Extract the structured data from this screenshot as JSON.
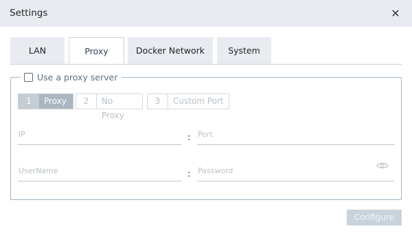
{
  "dialog": {
    "title": "Settings",
    "close_glyph": "✕"
  },
  "tabs": [
    {
      "label": "LAN",
      "active": false
    },
    {
      "label": "Proxy",
      "active": true
    },
    {
      "label": "Docker Network",
      "active": false
    },
    {
      "label": "System",
      "active": false
    }
  ],
  "proxy": {
    "use_proxy_label": "Use a proxy server",
    "use_proxy_checked": false,
    "steps": [
      {
        "number": "1",
        "label": "Proxy",
        "active": true
      },
      {
        "number": "2",
        "label": "No Proxy",
        "active": false
      },
      {
        "number": "3",
        "label": "Custom Port",
        "active": false
      }
    ],
    "ip_placeholder": "IP",
    "port_placeholder": "Port",
    "username_placeholder": "UserName",
    "password_placeholder": "Password",
    "separator": ":"
  },
  "footer": {
    "configure_label": "Configure"
  },
  "icons": {
    "close": "close-icon",
    "eye": "eye-icon"
  }
}
